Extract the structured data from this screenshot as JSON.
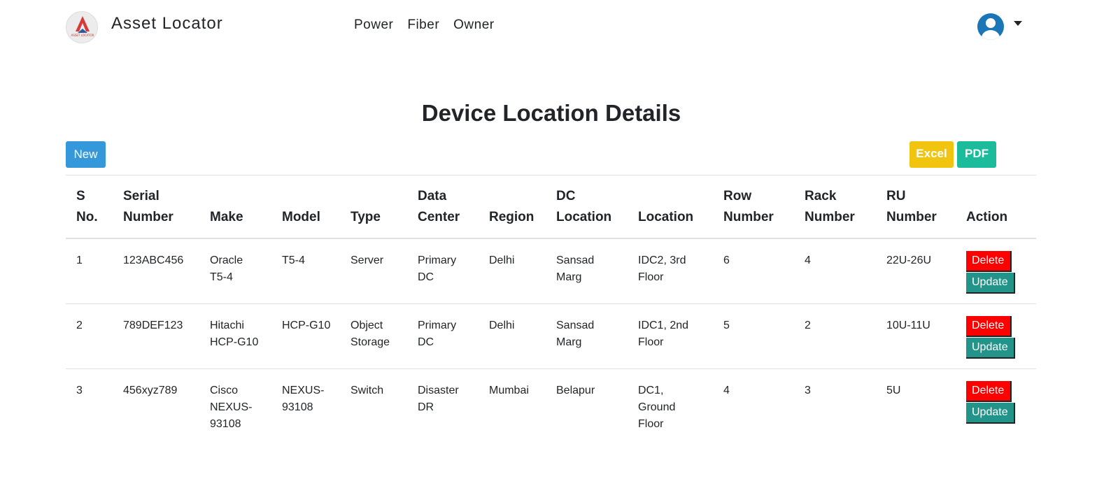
{
  "app": {
    "brand": "Asset Locator",
    "logo_text": "ASSET LOCATOR",
    "nav": [
      "Power",
      "Fiber",
      "Owner"
    ],
    "user_menu": {
      "avatar_icon": "user-avatar-icon",
      "caret_icon": "caret-down-icon"
    }
  },
  "page": {
    "title": "Device Location Details",
    "new_label": "New",
    "excel_label": "Excel",
    "pdf_label": "PDF"
  },
  "colors": {
    "new": "#3498db",
    "excel": "#f1c40f",
    "pdf": "#1abc9c",
    "delete": "#ff0000",
    "update": "#22948a",
    "avatar": "#1b76b8"
  },
  "table": {
    "headers": [
      [
        "S",
        "No."
      ],
      [
        "Serial",
        "Number"
      ],
      [
        "Make"
      ],
      [
        "Model"
      ],
      [
        "Type"
      ],
      [
        "Data",
        "Center"
      ],
      [
        "Region"
      ],
      [
        "DC",
        "Location"
      ],
      [
        "Location"
      ],
      [
        "Row",
        "Number"
      ],
      [
        "Rack",
        "Number"
      ],
      [
        "RU",
        "Number"
      ],
      [
        "Action"
      ]
    ],
    "rows": [
      {
        "cells": [
          [
            "1"
          ],
          [
            "123ABC456"
          ],
          [
            "Oracle",
            "T5-4"
          ],
          [
            "T5-4"
          ],
          [
            "Server"
          ],
          [
            "Primary",
            "DC"
          ],
          [
            "Delhi"
          ],
          [
            "Sansad",
            "Marg"
          ],
          [
            "IDC2, 3rd",
            "Floor"
          ],
          [
            "6"
          ],
          [
            "4"
          ],
          [
            "22U-26U"
          ]
        ],
        "delete_label": "Delete",
        "update_label": "Update"
      },
      {
        "cells": [
          [
            "2"
          ],
          [
            "789DEF123"
          ],
          [
            "Hitachi",
            "HCP-G10"
          ],
          [
            "HCP-G10"
          ],
          [
            "Object",
            "Storage"
          ],
          [
            "Primary",
            "DC"
          ],
          [
            "Delhi"
          ],
          [
            "Sansad",
            "Marg"
          ],
          [
            "IDC1, 2nd",
            "Floor"
          ],
          [
            "5"
          ],
          [
            "2"
          ],
          [
            "10U-11U"
          ]
        ],
        "delete_label": "Delete",
        "update_label": "Update"
      },
      {
        "cells": [
          [
            "3"
          ],
          [
            "456xyz789"
          ],
          [
            "Cisco",
            "NEXUS-",
            "93108"
          ],
          [
            "NEXUS-",
            "93108"
          ],
          [
            "Switch"
          ],
          [
            "Disaster",
            "DR"
          ],
          [
            "Mumbai"
          ],
          [
            "Belapur"
          ],
          [
            "DC1,",
            "Ground",
            "Floor"
          ],
          [
            "4"
          ],
          [
            "3"
          ],
          [
            "5U"
          ]
        ],
        "delete_label": "Delete",
        "update_label": "Update"
      }
    ]
  }
}
